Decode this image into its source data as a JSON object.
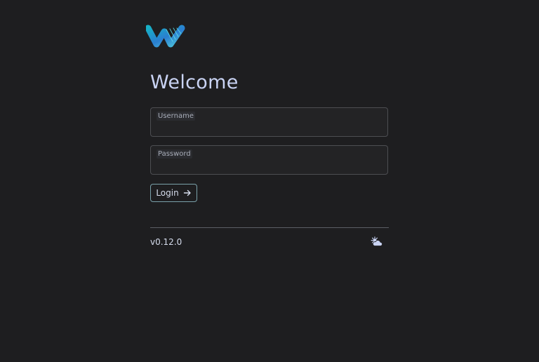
{
  "page": {
    "title": "Welcome"
  },
  "brand": {
    "logo_icon": "w-wave-logo-icon",
    "colors": [
      "#13a8c9",
      "#2a72c7",
      "#52d2dd"
    ]
  },
  "login_form": {
    "username_label": "Username",
    "username_value": "",
    "password_label": "Password",
    "password_value": "",
    "login_label": "Login",
    "login_icon": "arrow-right-icon"
  },
  "footer": {
    "version": "v0.12.0",
    "theme_icon": "sun-cloud-icon"
  },
  "colors": {
    "background": "#1e1e20",
    "text": "#c9d3f3",
    "button_border": "#7aa1aa"
  }
}
